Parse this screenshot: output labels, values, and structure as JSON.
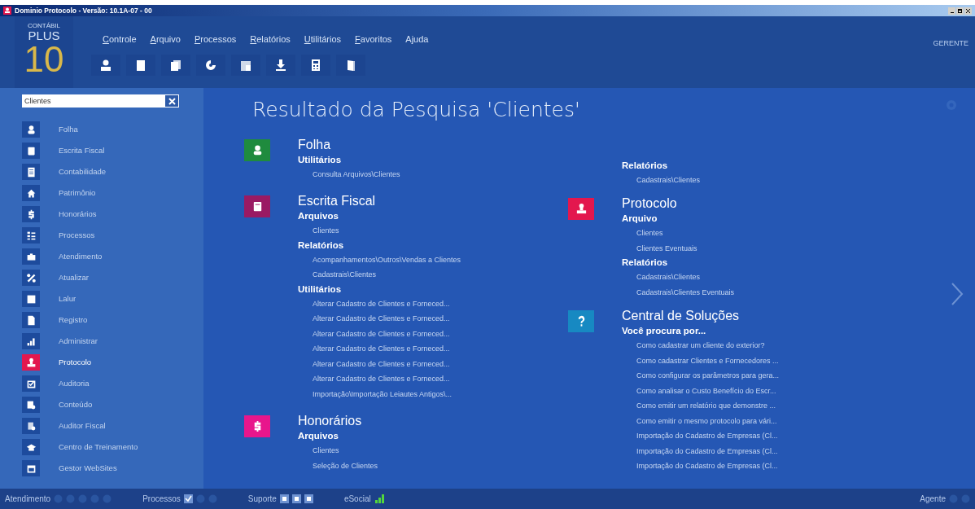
{
  "window": {
    "title": "Dominio Protocolo - Versão: 10.1A-07 - 00"
  },
  "logo": {
    "brand": "CONTÁBIL",
    "name": "PLUS",
    "version": "10"
  },
  "menu": [
    {
      "label": "Controle",
      "access_key": true
    },
    {
      "label": "Arquivo",
      "access_key": true
    },
    {
      "label": "Processos",
      "access_key": true
    },
    {
      "label": "Relatórios",
      "access_key": true
    },
    {
      "label": "Utilitários",
      "access_key": true
    },
    {
      "label": "Favoritos",
      "access_key": true
    },
    {
      "label": "Ajuda",
      "access_key": false
    }
  ],
  "user": "GERENTE",
  "search": {
    "value": "Clientes"
  },
  "sidebar": {
    "items": [
      {
        "label": "Folha",
        "selected": false
      },
      {
        "label": "Escrita Fiscal",
        "selected": false
      },
      {
        "label": "Contabilidade",
        "selected": false
      },
      {
        "label": "Patrimônio",
        "selected": false
      },
      {
        "label": "Honorários",
        "selected": false
      },
      {
        "label": "Processos",
        "selected": false
      },
      {
        "label": "Atendimento",
        "selected": false
      },
      {
        "label": "Atualizar",
        "selected": false
      },
      {
        "label": "Lalur",
        "selected": false
      },
      {
        "label": "Registro",
        "selected": false
      },
      {
        "label": "Administrar",
        "selected": false
      },
      {
        "label": "Protocolo",
        "selected": true
      },
      {
        "label": "Auditoria",
        "selected": false
      },
      {
        "label": "Conteúdo",
        "selected": false
      },
      {
        "label": "Auditor Fiscal",
        "selected": false
      },
      {
        "label": "Centro de Treinamento",
        "selected": false
      },
      {
        "label": "Gestor WebSites",
        "selected": false
      }
    ]
  },
  "results": {
    "title": "Resultado da Pesquisa 'Clientes'",
    "columns": [
      [
        {
          "name": "Folha",
          "color": "#1f8b3e",
          "groups": [
            {
              "heading": "Utilitários",
              "items": [
                "Consulta Arquivos\\Clientes"
              ]
            }
          ]
        },
        {
          "name": "Escrita Fiscal",
          "color": "#9a1a63",
          "groups": [
            {
              "heading": "Arquivos",
              "items": [
                "Clientes"
              ]
            },
            {
              "heading": "Relatórios",
              "items": [
                "Acompanhamentos\\Outros\\Vendas a Clientes",
                "Cadastrais\\Clientes"
              ]
            },
            {
              "heading": "Utilitários",
              "items": [
                "Alterar Cadastro de Clientes e Forneced...",
                "Alterar Cadastro de Clientes e Forneced...",
                "Alterar Cadastro de Clientes e Forneced...",
                "Alterar Cadastro de Clientes e Forneced...",
                "Alterar Cadastro de Clientes e Forneced...",
                "Alterar Cadastro de Clientes e Forneced...",
                "Importação\\Importação Leiautes Antigos\\..."
              ]
            }
          ]
        },
        {
          "name": "Honorários",
          "color": "#e8168c",
          "groups": [
            {
              "heading": "Arquivos",
              "items": [
                "Clientes",
                "Seleção de Clientes"
              ]
            }
          ]
        }
      ],
      [
        {
          "groups": [
            {
              "heading": "Relatórios",
              "items": [
                "Cadastrais\\Clientes"
              ]
            }
          ]
        },
        {
          "name": "Protocolo",
          "color": "#e3174e",
          "groups": [
            {
              "heading": "Arquivo",
              "items": [
                "Clientes",
                "Clientes Eventuais"
              ]
            },
            {
              "heading": "Relatórios",
              "items": [
                "Cadastrais\\Clientes",
                "Cadastrais\\Clientes Eventuais"
              ]
            }
          ]
        },
        {
          "name": "Central de Soluções",
          "color": "#1789c2",
          "groups": [
            {
              "heading": "Você procura por...",
              "items": [
                "Como cadastrar um cliente do exterior?",
                "Como cadastrar Clientes e Fornecedores ...",
                "Como configurar os parâmetros para gera...",
                "Como analisar o Custo Benefício do Escr...",
                "Como emitir um relatório que demonstre ...",
                "Como emitir o mesmo protocolo para vári...",
                "Importação do Cadastro de Empresas (Cl...",
                "Importação do Cadastro de Empresas (Cl...",
                "Importação do Cadastro de Empresas (Cl..."
              ]
            }
          ]
        }
      ]
    ]
  },
  "status_bar": {
    "sections": [
      {
        "label": "Atendimento",
        "icons": [
          {
            "kind": "dim"
          },
          {
            "kind": "dim"
          },
          {
            "kind": "dim"
          },
          {
            "kind": "dim"
          },
          {
            "kind": "dim"
          }
        ]
      },
      {
        "label": "Processos",
        "icons": [
          {
            "kind": "check"
          },
          {
            "kind": "dim"
          },
          {
            "kind": "dim"
          }
        ]
      },
      {
        "label": "Suporte",
        "icons": [
          {
            "kind": "support"
          },
          {
            "kind": "support"
          },
          {
            "kind": "support"
          }
        ]
      },
      {
        "label": "eSocial",
        "icons": [
          {
            "kind": "signal"
          }
        ]
      },
      {
        "label": "Agente",
        "icons": [
          {
            "kind": "dim"
          },
          {
            "kind": "dim"
          }
        ]
      }
    ]
  }
}
